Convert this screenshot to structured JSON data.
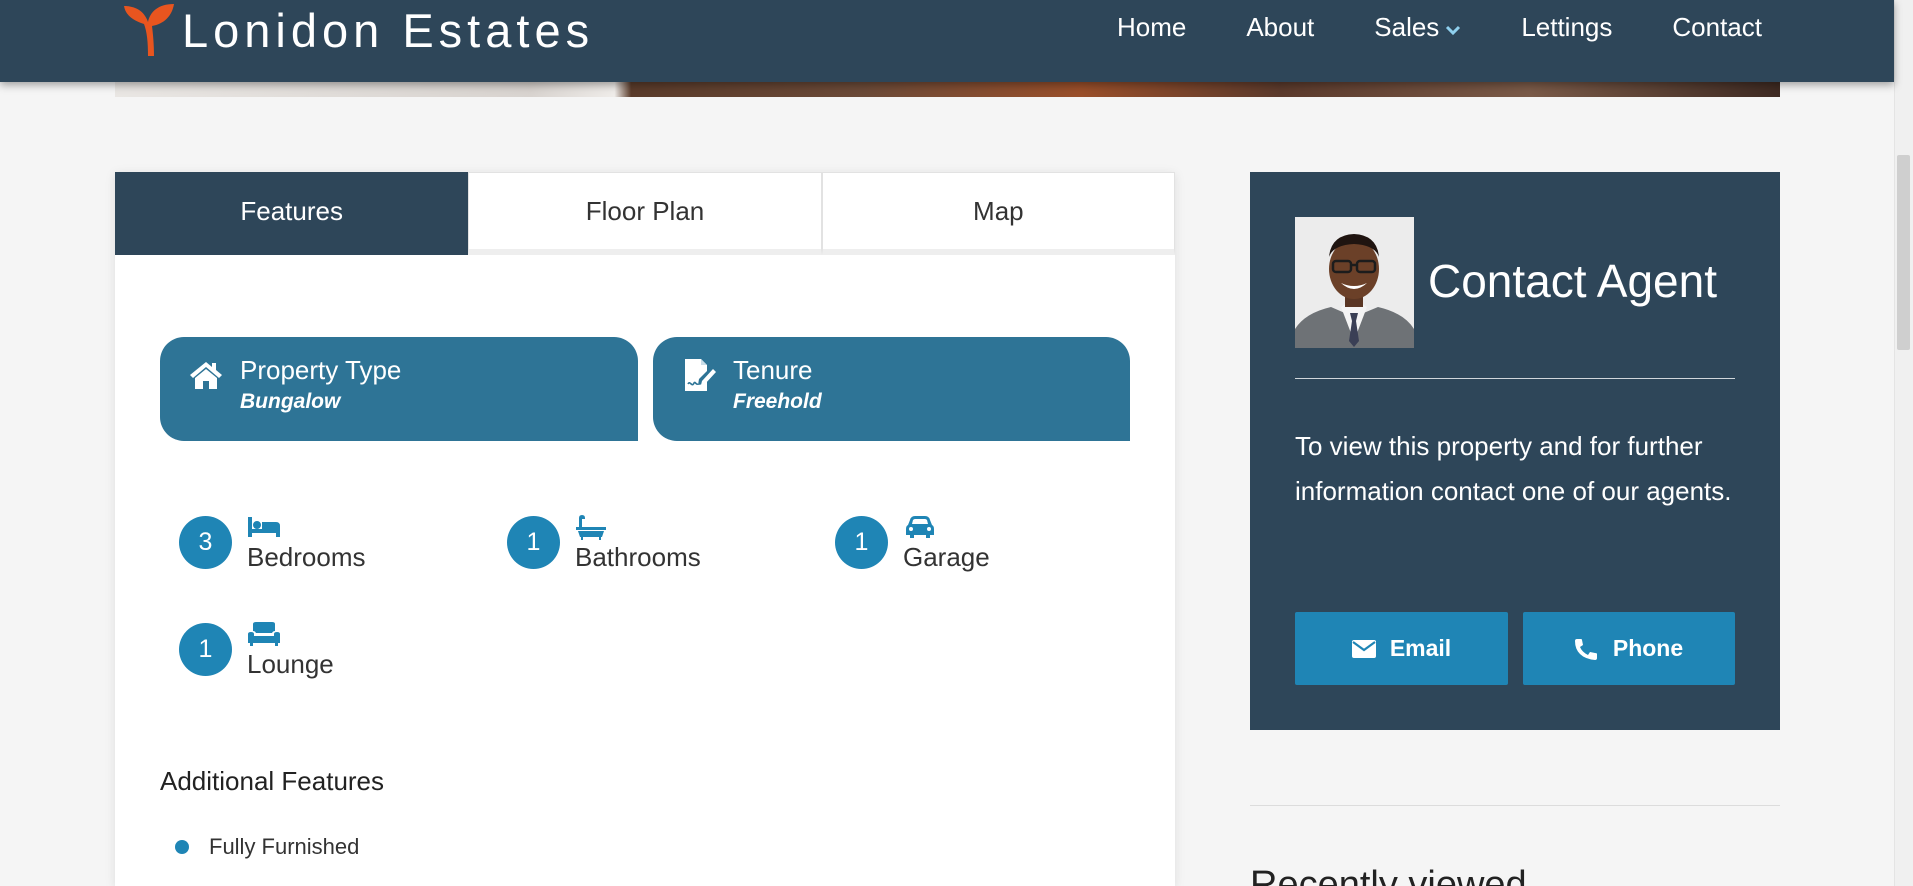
{
  "header": {
    "logo_text": "Lonidon Estates",
    "nav": [
      {
        "label": "Home"
      },
      {
        "label": "About"
      },
      {
        "label": "Sales",
        "has_dropdown": true
      },
      {
        "label": "Lettings"
      },
      {
        "label": "Contact"
      }
    ],
    "colors": {
      "bar": "#2e4659",
      "logo_mark": "#e8551f"
    }
  },
  "tabs": [
    {
      "label": "Features",
      "active": true
    },
    {
      "label": "Floor Plan",
      "active": false
    },
    {
      "label": "Map",
      "active": false
    }
  ],
  "info_boxes": [
    {
      "icon": "house-icon",
      "title": "Property Type",
      "value": "Bungalow"
    },
    {
      "icon": "contract-signature-icon",
      "title": "Tenure",
      "value": "Freehold"
    }
  ],
  "rooms": [
    {
      "count": "3",
      "icon": "bed-icon",
      "label": "Bedrooms"
    },
    {
      "count": "1",
      "icon": "bath-icon",
      "label": "Bathrooms"
    },
    {
      "count": "1",
      "icon": "car-icon",
      "label": "Garage"
    },
    {
      "count": "1",
      "icon": "sofa-icon",
      "label": "Lounge"
    }
  ],
  "additional_features": {
    "heading": "Additional Features",
    "items": [
      "Fully Furnished"
    ]
  },
  "contact": {
    "title": "Contact Agent",
    "text": "To view this property and for further information contact one of our agents.",
    "email_label": "Email",
    "phone_label": "Phone"
  },
  "recently_viewed": {
    "heading": "Recently viewed"
  },
  "colors": {
    "accent": "#1f85b5",
    "info_box": "#2e7496",
    "panel": "#2e4659"
  }
}
